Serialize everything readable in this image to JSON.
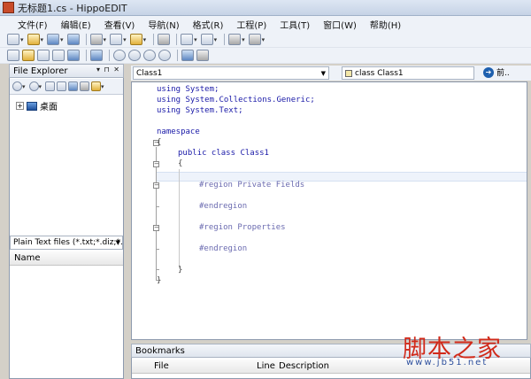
{
  "window": {
    "title": "无标题1.cs - HippoEDIT"
  },
  "menu": {
    "items": [
      "文件(F)",
      "编辑(E)",
      "查看(V)",
      "导航(N)",
      "格式(R)",
      "工程(P)",
      "工具(T)",
      "窗口(W)",
      "帮助(H)"
    ]
  },
  "file_explorer": {
    "title": "File Explorer",
    "header_buttons": "▾ ⊓ ✕",
    "tree_root": "桌面",
    "filter": "Plain Text files (*.txt;*.diz;*.l",
    "name_column": "Name"
  },
  "editor": {
    "class_combo": "Class1",
    "member_combo": "class Class1",
    "go_label": "前..",
    "lines": [
      "using System;",
      "using System.Collections.Generic;",
      "using System.Text;",
      "namespace",
      "{",
      "public class Class1",
      "{",
      "#region Private Fields",
      "#endregion",
      "#region Properties",
      "#endregion",
      "}",
      "}"
    ]
  },
  "bookmarks": {
    "title": "Bookmarks",
    "columns": [
      "File",
      "Line",
      "Description"
    ]
  },
  "watermark": {
    "text": "脚本之家",
    "url": "www.jb51.net"
  },
  "icons": {
    "toolbar": [
      "new-icon",
      "open-icon",
      "save-icon",
      "save-all-icon",
      "cut-icon",
      "copy-icon",
      "paste-icon",
      "print-icon",
      "undo-icon",
      "redo-icon",
      "find-icon",
      "replace-icon",
      "indent-icon",
      "outdent-icon",
      "comment-icon",
      "bookmark-icon"
    ]
  }
}
